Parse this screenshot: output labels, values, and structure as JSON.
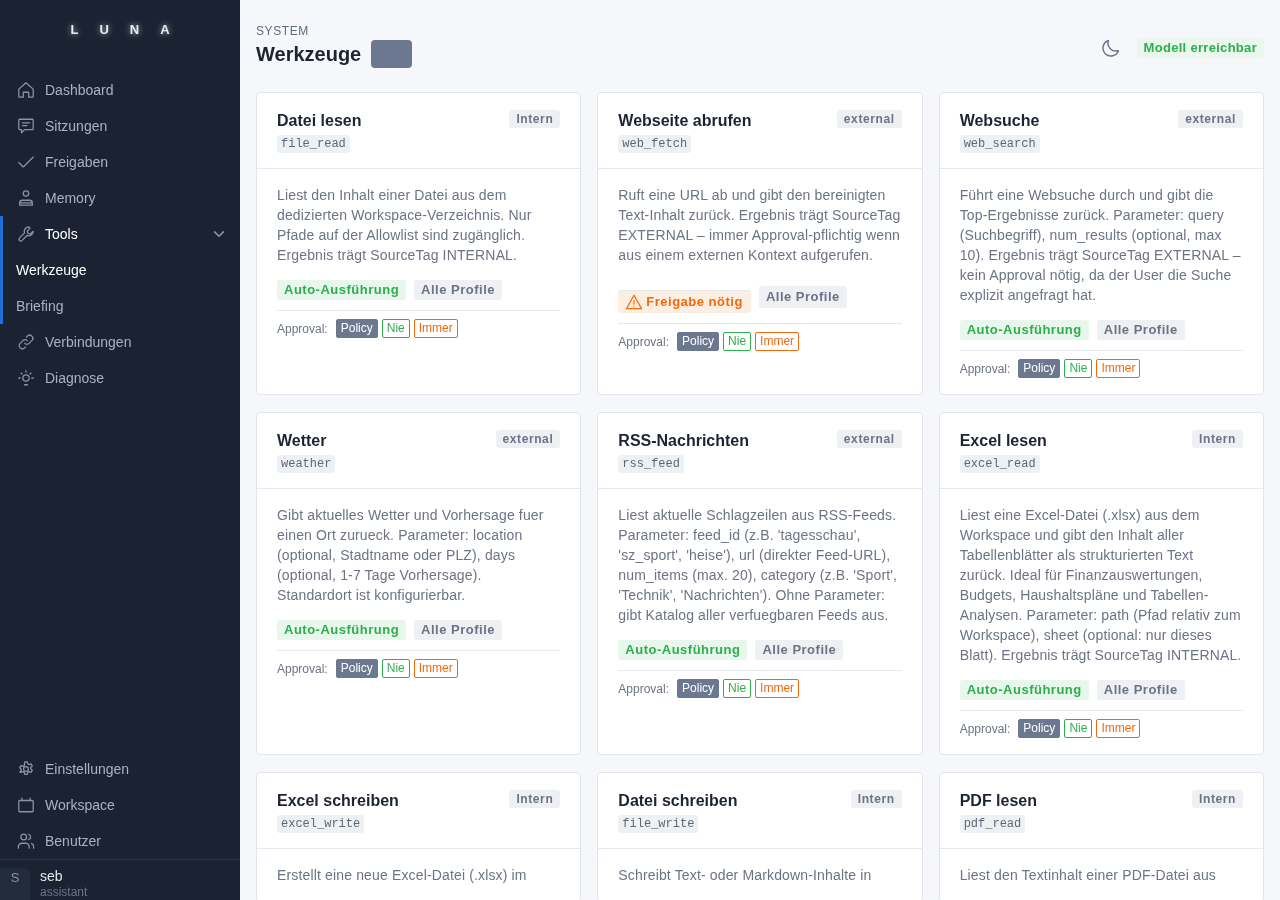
{
  "sidebar": {
    "logo": "LUNA",
    "items": [
      {
        "label": "Dashboard",
        "selected": false
      },
      {
        "label": "Sitzungen",
        "selected": false
      },
      {
        "label": "Freigaben",
        "selected": false
      },
      {
        "label": "Memory",
        "selected": false
      },
      {
        "label": "Tools",
        "selected": true,
        "expanded": true,
        "children": [
          {
            "label": "Werkzeuge",
            "selected": true
          },
          {
            "label": "Briefing",
            "selected": false
          }
        ]
      },
      {
        "label": "Verbindungen",
        "selected": false
      },
      {
        "label": "Diagnose",
        "selected": false
      }
    ],
    "bottom_items": [
      {
        "label": "Einstellungen",
        "selected": false
      },
      {
        "label": "Workspace",
        "selected": false
      },
      {
        "label": "Benutzer",
        "selected": false
      }
    ],
    "user": {
      "initial": "S",
      "name": "seb",
      "role": "assistant"
    }
  },
  "header": {
    "eyebrow": "SYSTEM",
    "title": "Werkzeuge",
    "status": "Modell erreichbar"
  },
  "cards": [
    {
      "title": "Datei lesen",
      "name": "file_read",
      "scope": "Intern",
      "description": "Liest den Inhalt einer Datei aus dem dedizierten Workspace-Verzeichnis. Nur Pfade auf der Allowlist sind zugänglich. Ergebnis trägt SourceTag INTERNAL.",
      "badges": [
        {
          "kind": "auto",
          "label": "Auto-Ausführung"
        },
        {
          "kind": "profile",
          "label": "Alle Profile"
        }
      ],
      "approval": {
        "label": "Approval:",
        "options": [
          {
            "kind": "policy",
            "label": "Policy",
            "selected": true
          },
          {
            "kind": "never",
            "label": "Nie",
            "selected": false
          },
          {
            "kind": "always",
            "label": "Immer",
            "selected": false
          }
        ]
      }
    },
    {
      "title": "Webseite abrufen",
      "name": "web_fetch",
      "scope": "external",
      "description": "Ruft eine URL ab und gibt den bereinigten Text-Inhalt zurück. Ergebnis trägt SourceTag EXTERNAL – immer Approval-pflichtig wenn aus einem externen Kontext aufgerufen.",
      "badges": [
        {
          "kind": "approval",
          "label": "Freigabe nötig"
        },
        {
          "kind": "profile",
          "label": "Alle Profile"
        }
      ],
      "approval": {
        "label": "Approval:",
        "options": [
          {
            "kind": "policy",
            "label": "Policy",
            "selected": true
          },
          {
            "kind": "never",
            "label": "Nie",
            "selected": false
          },
          {
            "kind": "always",
            "label": "Immer",
            "selected": false
          }
        ]
      }
    },
    {
      "title": "Websuche",
      "name": "web_search",
      "scope": "external",
      "description": "Führt eine Websuche durch und gibt die Top-Ergebnisse zurück. Parameter: query (Suchbegriff), num_results (optional, max 10). Ergebnis trägt SourceTag EXTERNAL – kein Approval nötig, da der User die Suche explizit angefragt hat.",
      "badges": [
        {
          "kind": "auto",
          "label": "Auto-Ausführung"
        },
        {
          "kind": "profile",
          "label": "Alle Profile"
        }
      ],
      "approval": {
        "label": "Approval:",
        "options": [
          {
            "kind": "policy",
            "label": "Policy",
            "selected": true
          },
          {
            "kind": "never",
            "label": "Nie",
            "selected": false
          },
          {
            "kind": "always",
            "label": "Immer",
            "selected": false
          }
        ]
      }
    },
    {
      "title": "Wetter",
      "name": "weather",
      "scope": "external",
      "description": "Gibt aktuelles Wetter und Vorhersage fuer einen Ort zurueck. Parameter: location (optional, Stadtname oder PLZ), days (optional, 1-7 Tage Vorhersage). Standardort ist konfigurierbar.",
      "badges": [
        {
          "kind": "auto",
          "label": "Auto-Ausführung"
        },
        {
          "kind": "profile",
          "label": "Alle Profile"
        }
      ],
      "approval": {
        "label": "Approval:",
        "options": [
          {
            "kind": "policy",
            "label": "Policy",
            "selected": true
          },
          {
            "kind": "never",
            "label": "Nie",
            "selected": false
          },
          {
            "kind": "always",
            "label": "Immer",
            "selected": false
          }
        ]
      }
    },
    {
      "title": "RSS-Nachrichten",
      "name": "rss_feed",
      "scope": "external",
      "description": "Liest aktuelle Schlagzeilen aus RSS-Feeds. Parameter: feed_id (z.B. 'tagesschau', 'sz_sport', 'heise'), url (direkter Feed-URL), num_items (max. 20), category (z.B. 'Sport', 'Technik', 'Nachrichten'). Ohne Parameter: gibt Katalog aller verfuegbaren Feeds aus.",
      "badges": [
        {
          "kind": "auto",
          "label": "Auto-Ausführung"
        },
        {
          "kind": "profile",
          "label": "Alle Profile"
        }
      ],
      "approval": {
        "label": "Approval:",
        "options": [
          {
            "kind": "policy",
            "label": "Policy",
            "selected": true
          },
          {
            "kind": "never",
            "label": "Nie",
            "selected": false
          },
          {
            "kind": "always",
            "label": "Immer",
            "selected": false
          }
        ]
      }
    },
    {
      "title": "Excel lesen",
      "name": "excel_read",
      "scope": "Intern",
      "description": "Liest eine Excel-Datei (.xlsx) aus dem Workspace und gibt den Inhalt aller Tabellenblätter als strukturierten Text zurück. Ideal für Finanzauswertungen, Budgets, Haushaltspläne und Tabellen-Analysen. Parameter: path (Pfad relativ zum Workspace), sheet (optional: nur dieses Blatt). Ergebnis trägt SourceTag INTERNAL.",
      "badges": [
        {
          "kind": "auto",
          "label": "Auto-Ausführung"
        },
        {
          "kind": "profile",
          "label": "Alle Profile"
        }
      ],
      "approval": {
        "label": "Approval:",
        "options": [
          {
            "kind": "policy",
            "label": "Policy",
            "selected": true
          },
          {
            "kind": "never",
            "label": "Nie",
            "selected": false
          },
          {
            "kind": "always",
            "label": "Immer",
            "selected": false
          }
        ]
      }
    },
    {
      "title": "Excel schreiben",
      "name": "excel_write",
      "scope": "Intern",
      "description": "Erstellt eine neue Excel-Datei (.xlsx) im"
    },
    {
      "title": "Datei schreiben",
      "name": "file_write",
      "scope": "Intern",
      "description": "Schreibt Text- oder Markdown-Inhalte in"
    },
    {
      "title": "PDF lesen",
      "name": "pdf_read",
      "scope": "Intern",
      "description": "Liest den Textinhalt einer PDF-Datei aus"
    }
  ]
}
